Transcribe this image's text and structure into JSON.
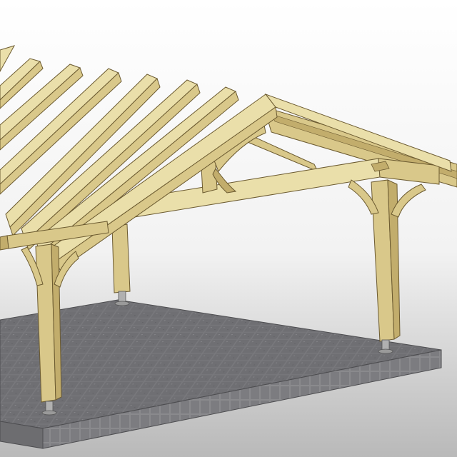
{
  "scene": {
    "subject": "timber-frame-carport",
    "rafter_count": 8,
    "post_count": 4,
    "colors": {
      "timber_top": "#eadfaa",
      "timber_side": "#d9c88a",
      "timber_dark": "#c2ad6c",
      "timber_edge": "#6b5a30",
      "paving": "#76767a",
      "paving_edge": "#5a5a5e",
      "background_top": "#ffffff",
      "background_bottom": "#b9b9b9",
      "metal_base": "#b0b0b0"
    }
  }
}
